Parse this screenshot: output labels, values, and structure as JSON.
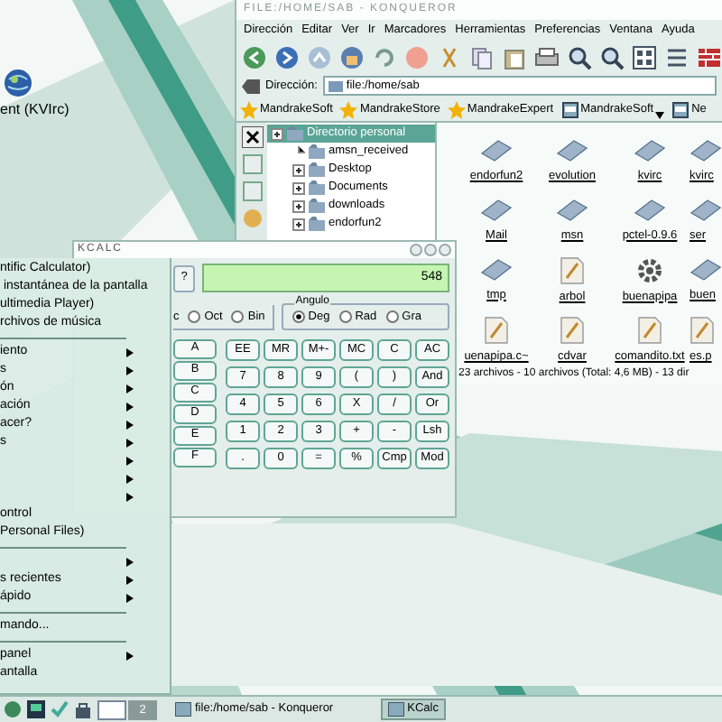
{
  "desktop": {
    "icons": [
      {
        "label": "ent (KVIrc)"
      }
    ]
  },
  "konqueror": {
    "title": "FILE:/HOME/SAB - KONQUEROR",
    "menu": [
      "Dirección",
      "Editar",
      "Ver",
      "Ir",
      "Marcadores",
      "Herramientas",
      "Preferencias",
      "Ventana",
      "Ayuda"
    ],
    "location": {
      "label": "Dirección:",
      "value": "file:/home/sab"
    },
    "bookmarks": [
      {
        "label": "MandrakeSoft",
        "kind": "star"
      },
      {
        "label": "MandrakeStore",
        "kind": "star"
      },
      {
        "label": "MandrakeExpert",
        "kind": "star"
      },
      {
        "label": "MandrakeSoft",
        "kind": "page",
        "dropdown": true
      },
      {
        "label": "Ne",
        "kind": "page",
        "dropdown": false
      }
    ],
    "tree": [
      {
        "label": "Directorio personal",
        "selected": true,
        "expandable": true,
        "children": [
          {
            "label": "amsn_received",
            "selected": false,
            "expandable": false
          },
          {
            "label": "Desktop",
            "selected": false,
            "expandable": true
          },
          {
            "label": "Documents",
            "selected": false,
            "expandable": true
          },
          {
            "label": "downloads",
            "selected": false,
            "expandable": true
          },
          {
            "label": "endorfun2",
            "selected": false,
            "expandable": true
          }
        ]
      }
    ],
    "files": [
      {
        "name": "endorfun2",
        "kind": "folder"
      },
      {
        "name": "evolution",
        "kind": "folder"
      },
      {
        "name": "kvirc",
        "kind": "folder"
      },
      {
        "name": "kvirc",
        "kind": "folder"
      },
      {
        "name": "Mail",
        "kind": "folder"
      },
      {
        "name": "msn",
        "kind": "folder"
      },
      {
        "name": "pctel-0.9.6",
        "kind": "folder"
      },
      {
        "name": "ser",
        "kind": "folder"
      },
      {
        "name": "tmp",
        "kind": "folder"
      },
      {
        "name": "arbol",
        "kind": "text"
      },
      {
        "name": "buenapipa",
        "kind": "program"
      },
      {
        "name": "buen",
        "kind": "folder"
      },
      {
        "name": "uenapipa.c~",
        "kind": "text"
      },
      {
        "name": "cdvar",
        "kind": "text"
      },
      {
        "name": "comandito.txt",
        "kind": "text"
      },
      {
        "name": "es.p",
        "kind": "text"
      }
    ],
    "status_bar": "23 archivos - 10 archivos (Total: 4,6 MB) - 13 dir"
  },
  "kcalc": {
    "title": "KCALC",
    "help": "?",
    "display": "548",
    "base_fragment": "c",
    "base_options": [
      {
        "label": "Oct",
        "selected": false
      },
      {
        "label": "Bin",
        "selected": false
      }
    ],
    "angle": {
      "title": "Angulo",
      "options": [
        {
          "label": "Deg",
          "selected": true
        },
        {
          "label": "Rad",
          "selected": false
        },
        {
          "label": "Gra",
          "selected": false
        }
      ]
    },
    "hex_keys": [
      "A",
      "B",
      "C",
      "D",
      "E",
      "F"
    ],
    "keys": [
      [
        "EE",
        "MR",
        "M+-",
        "MC",
        "C",
        "AC"
      ],
      [
        "7",
        "8",
        "9",
        "(",
        ")",
        "And"
      ],
      [
        "4",
        "5",
        "6",
        "X",
        "/",
        "Or"
      ],
      [
        "1",
        "2",
        "3",
        "+",
        "-",
        "Lsh"
      ],
      [
        ".",
        "0",
        "=",
        "%",
        "Cmp",
        "Mod"
      ]
    ]
  },
  "start_menu": {
    "items": [
      {
        "kind": "item",
        "label": "ntific Calculator)",
        "submenu": false
      },
      {
        "kind": "item",
        "label": " instantánea de la pantalla",
        "submenu": false
      },
      {
        "kind": "item",
        "label": "ultimedia Player)",
        "submenu": false
      },
      {
        "kind": "item",
        "label": "rchivos de música",
        "submenu": false
      },
      {
        "kind": "separator"
      },
      {
        "kind": "item",
        "label": "iento",
        "submenu": true
      },
      {
        "kind": "item",
        "label": "s",
        "submenu": true
      },
      {
        "kind": "item",
        "label": "ón",
        "submenu": true
      },
      {
        "kind": "item",
        "label": "ación",
        "submenu": true
      },
      {
        "kind": "item",
        "label": "acer?",
        "submenu": true
      },
      {
        "kind": "item",
        "label": "s",
        "submenu": true
      },
      {
        "kind": "item",
        "submenu": true
      },
      {
        "kind": "item",
        "submenu": true
      },
      {
        "kind": "item",
        "submenu": true
      },
      {
        "kind": "item",
        "label": "ontrol",
        "submenu": false
      },
      {
        "kind": "item",
        "label": "Personal Files)",
        "submenu": false
      },
      {
        "kind": "separator"
      },
      {
        "kind": "item",
        "submenu": true
      },
      {
        "kind": "item",
        "label": "s recientes",
        "submenu": true
      },
      {
        "kind": "item",
        "label": "ápido",
        "submenu": true
      },
      {
        "kind": "separator"
      },
      {
        "kind": "item",
        "label": "mando...",
        "submenu": false
      },
      {
        "kind": "separator"
      },
      {
        "kind": "item",
        "label": "panel",
        "submenu": true
      },
      {
        "kind": "item",
        "label": "antalla",
        "submenu": false
      }
    ]
  },
  "taskbar": {
    "pager": [
      {
        "selected": true
      },
      {
        "label": "2",
        "selected": false
      }
    ],
    "tasks": [
      {
        "label": "file:/home/sab - Konqueror",
        "selected": false
      },
      {
        "label": "KCalc",
        "selected": true
      }
    ]
  }
}
